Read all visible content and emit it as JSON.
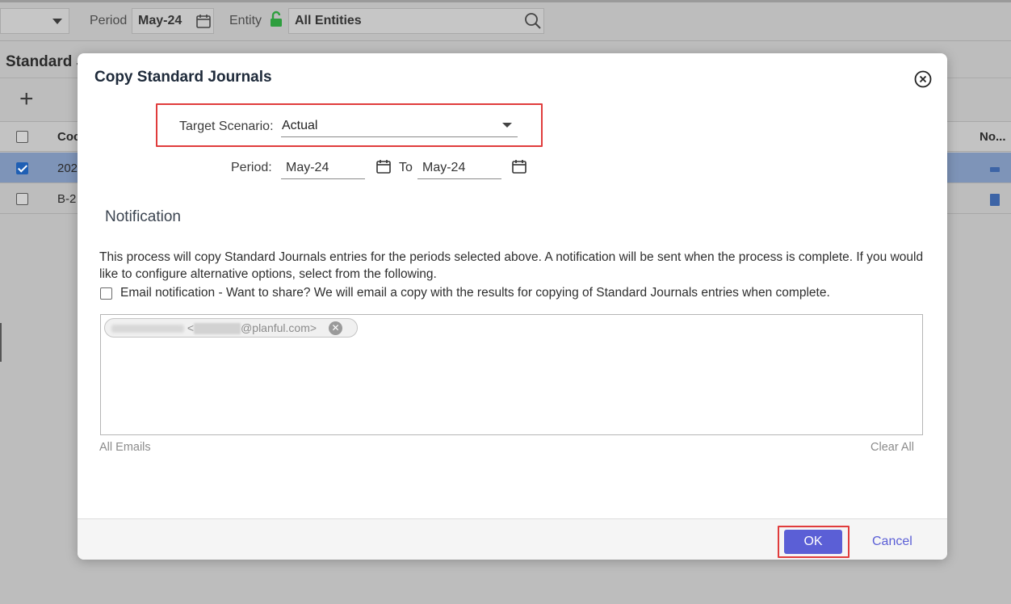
{
  "background": {
    "period_label": "Period",
    "period_value": "May-24",
    "entity_label": "Entity",
    "entity_value": "All Entities",
    "page_title": "Standard J",
    "add_label": "+",
    "columns": {
      "code": "Coc",
      "notes": "No..."
    },
    "rows": [
      {
        "code": "202",
        "checked": true
      },
      {
        "code": "B-2",
        "checked": false
      }
    ]
  },
  "modal": {
    "title": "Copy Standard Journals",
    "target_scenario_label": "Target Scenario:",
    "target_scenario_value": "Actual",
    "period_label": "Period:",
    "period_from": "May-24",
    "to_label": "To",
    "period_to": "May-24",
    "notification_title": "Notification",
    "description": "This process will copy Standard Journals entries for the periods selected above. A notification will be sent when the process is complete. If you would like to configure alternative options, select from the following.",
    "email_notification_label": "Email notification - Want to share? We will email a copy with the results for copying of Standard Journals entries when complete.",
    "email_chip_suffix": "@planful.com>",
    "all_emails_label": "All Emails",
    "clear_all_label": "Clear All",
    "ok_label": "OK",
    "cancel_label": "Cancel"
  },
  "colors": {
    "accent": "#5b5fd6",
    "highlight": "#e03c3c",
    "selected_row": "#7e94b8",
    "lock": "#2e9e3e"
  }
}
